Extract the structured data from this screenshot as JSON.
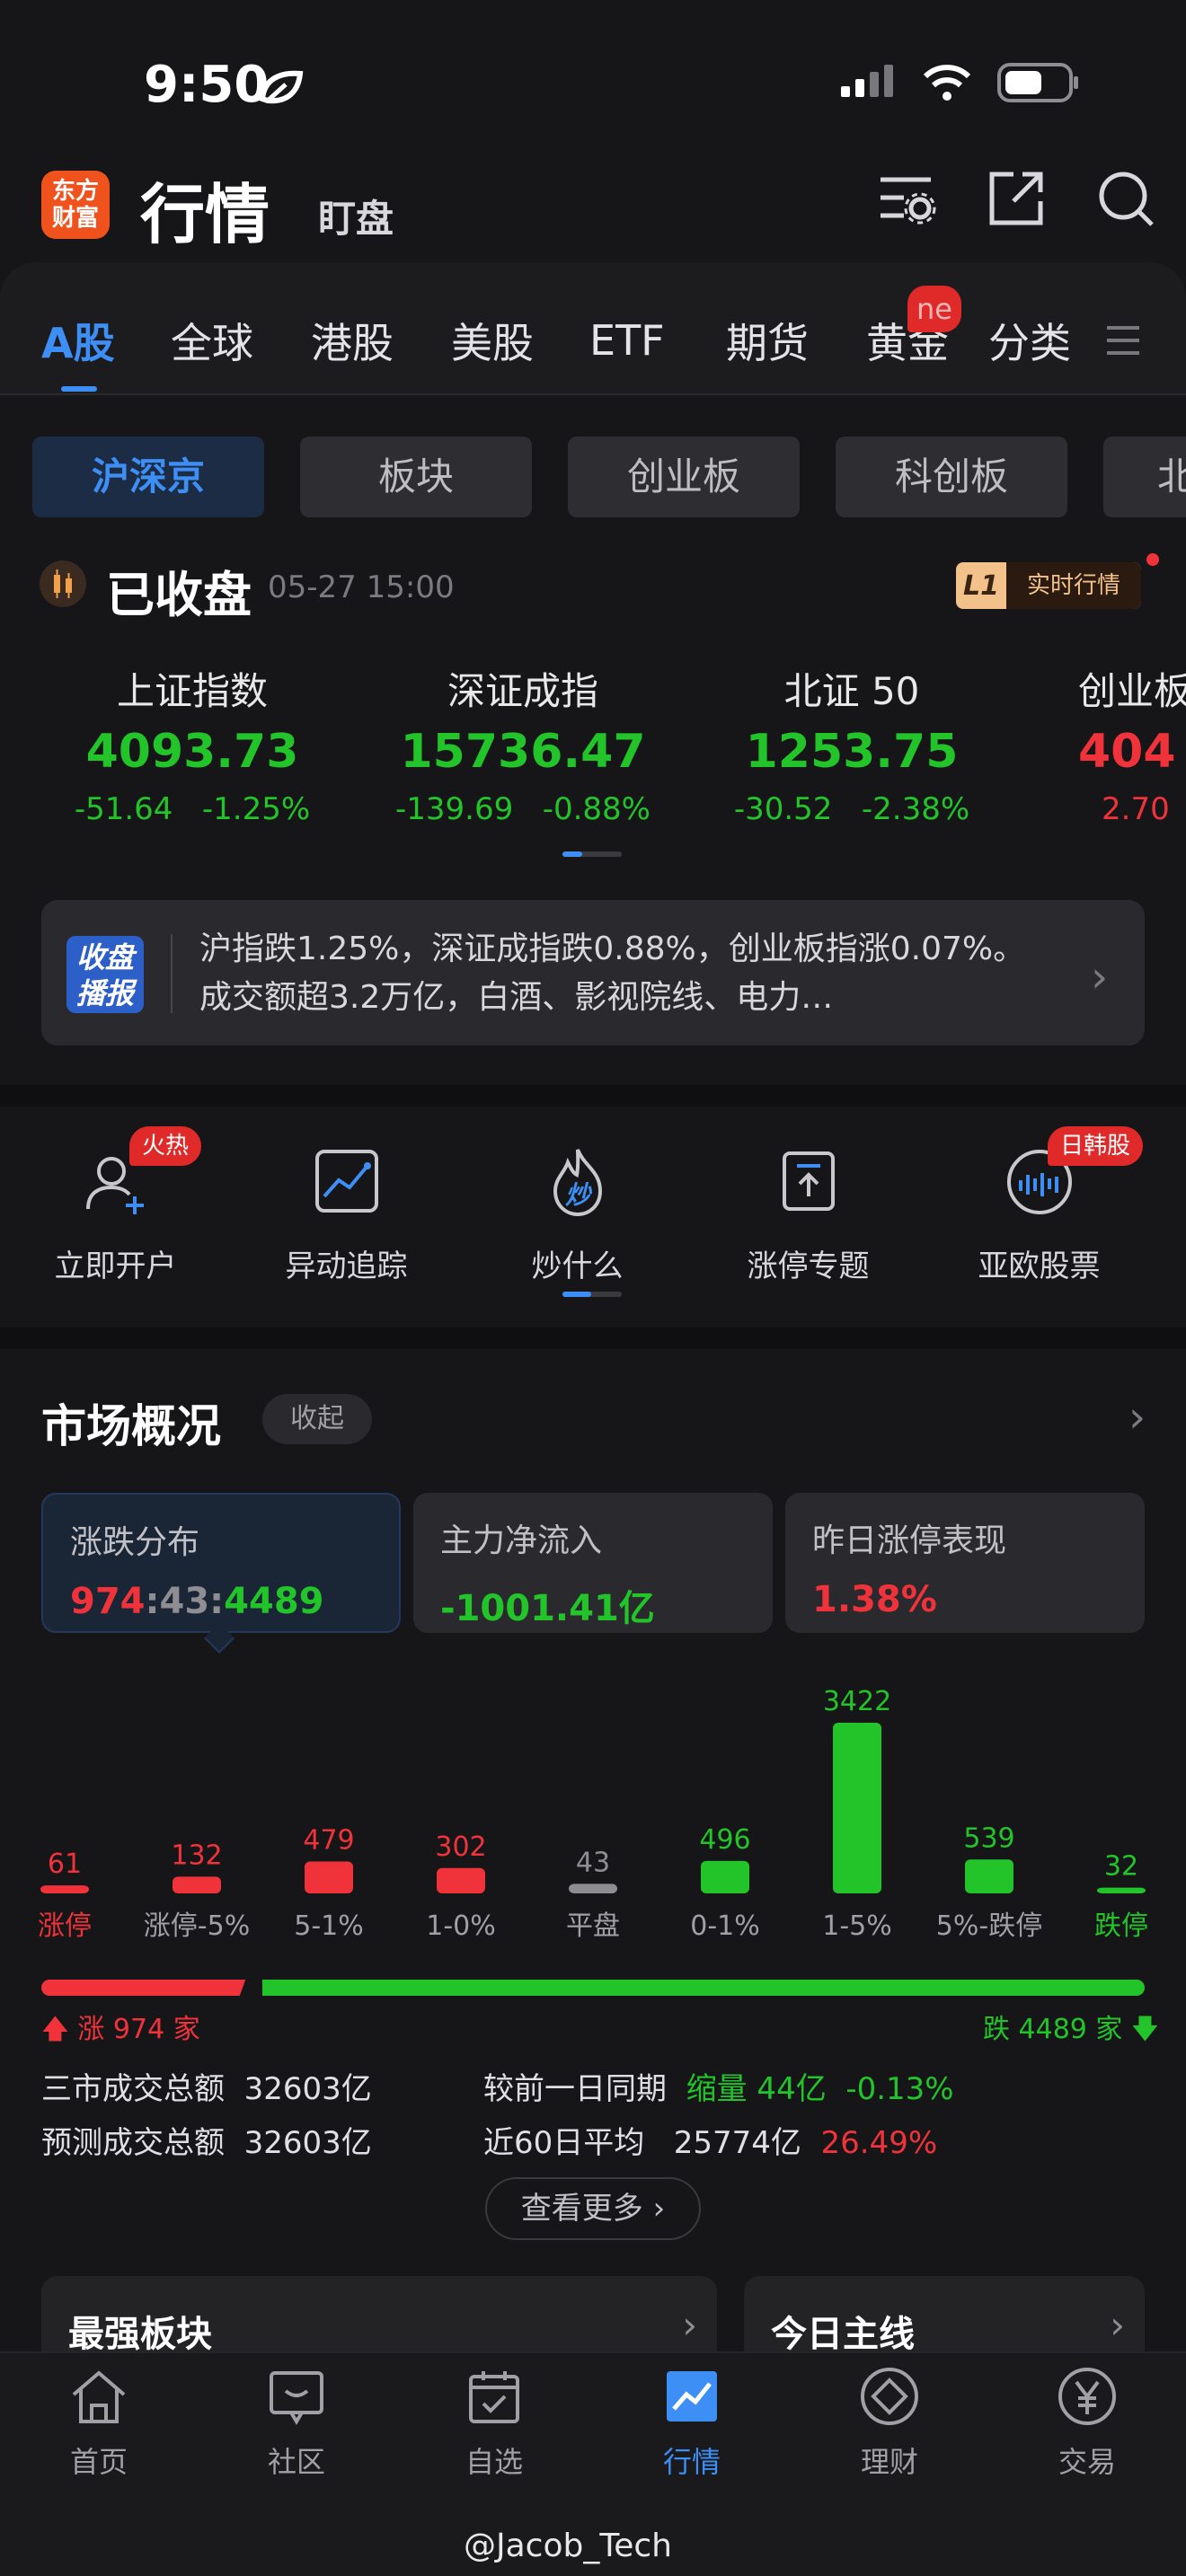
{
  "status_bar": {
    "time": "9:50"
  },
  "header": {
    "logo_line1": "东方",
    "logo_line2": "财富",
    "title": "行情",
    "subtitle": "盯盘"
  },
  "tabs": [
    "A股",
    "全球",
    "港股",
    "美股",
    "ETF",
    "期货",
    "黄金",
    "分类"
  ],
  "new_badge": "ne",
  "subtabs": [
    "沪深京",
    "板块",
    "创业板",
    "科创板",
    "北"
  ],
  "market_status": {
    "label": "已收盘",
    "time": "05-27 15:00",
    "l1": "L1",
    "realtime": "实时行情"
  },
  "indices": [
    {
      "name": "上证指数",
      "value": "4093.73",
      "change": "-51.64",
      "pct": "-1.25%",
      "dir": "down"
    },
    {
      "name": "深证成指",
      "value": "15736.47",
      "change": "-139.69",
      "pct": "-0.88%",
      "dir": "down"
    },
    {
      "name": "北证 50",
      "value": "1253.75",
      "change": "-30.52",
      "pct": "-2.38%",
      "dir": "down"
    },
    {
      "name": "创业板",
      "value": "404",
      "change": "2.70",
      "pct": "",
      "dir": "up"
    }
  ],
  "broadcast": {
    "badge_line1": "收盘",
    "badge_line2": "播报",
    "text": "沪指跌1.25%，深证成指跌0.88%，创业板指涨0.07%。成交额超3.2万亿，白酒、影视院线、电力…"
  },
  "shortcuts": [
    {
      "label": "立即开户",
      "badge": "火热"
    },
    {
      "label": "异动追踪",
      "badge": ""
    },
    {
      "label": "炒什么",
      "badge": "",
      "icon_text": "炒"
    },
    {
      "label": "涨停专题",
      "badge": ""
    },
    {
      "label": "亚欧股票",
      "badge": "日韩股"
    }
  ],
  "market_overview": {
    "title": "市场概况",
    "fold": "收起",
    "cards": [
      {
        "title": "涨跌分布",
        "up": "974",
        "flat": "43",
        "down": "4489",
        "sep": ":"
      },
      {
        "title": "主力净流入",
        "value": "-1001.41亿"
      },
      {
        "title": "昨日涨停表现",
        "value": "1.38%"
      }
    ]
  },
  "chart_data": {
    "type": "bar",
    "categories": [
      "涨停",
      "涨停-5%",
      "5-1%",
      "1-0%",
      "平盘",
      "0-1%",
      "1-5%",
      "5%-跌停",
      "跌停"
    ],
    "values": [
      61,
      132,
      479,
      302,
      43,
      496,
      3422,
      539,
      32
    ],
    "colors": [
      "#f0333b",
      "#f0333b",
      "#f0333b",
      "#f0333b",
      "#8d8d92",
      "#22c42a",
      "#22c42a",
      "#22c42a",
      "#22c42a"
    ]
  },
  "ratio": {
    "up_text": "涨 974 家",
    "down_text": "跌 4489 家",
    "up": 974,
    "down": 4489
  },
  "stats": {
    "total_label": "三市成交总额",
    "total_value": "32603亿",
    "compare_label": "较前一日同期",
    "compare_volume": "缩量 44亿",
    "compare_pct": "-0.13%",
    "forecast_label": "预测成交总额",
    "forecast_value": "32603亿",
    "avg_label": "近60日平均",
    "avg_value": "25774亿",
    "avg_pct": "26.49%"
  },
  "more_button": "查看更多",
  "bottom_cards": [
    "最强板块",
    "今日主线"
  ],
  "bottom_nav": [
    "首页",
    "社区",
    "自选",
    "行情",
    "理财",
    "交易"
  ],
  "watermark": "@Jacob_Tech"
}
